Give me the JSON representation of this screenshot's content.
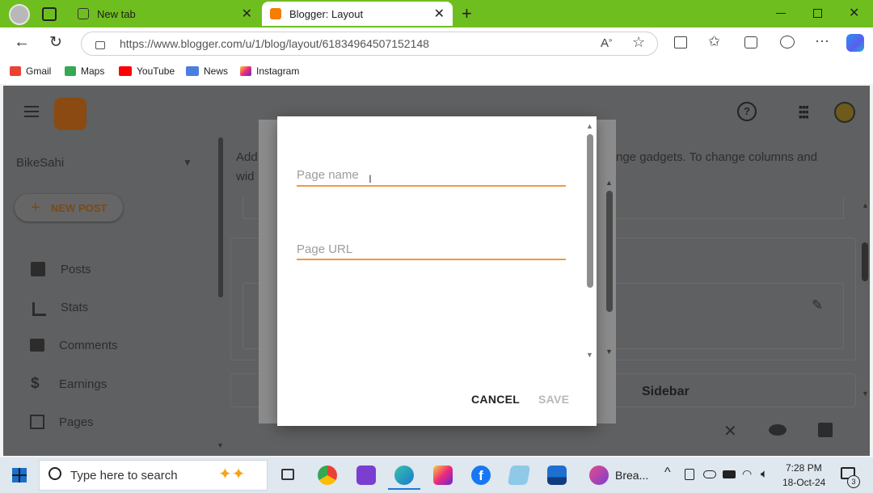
{
  "browser": {
    "tabs": [
      {
        "label": "New tab"
      },
      {
        "label": "Blogger: Layout"
      }
    ],
    "url": "https://www.blogger.com/u/1/blog/layout/61834964507152148",
    "bookmarks": [
      "Gmail",
      "Maps",
      "YouTube",
      "News",
      "Instagram"
    ]
  },
  "blogger": {
    "blog_name": "BikeSahi",
    "new_post": "NEW POST",
    "nav": [
      "Posts",
      "Stats",
      "Comments",
      "Earnings",
      "Pages"
    ],
    "intro_left_1": "Add",
    "intro_left_2": "wid",
    "intro_right": "nge gadgets. To change columns and",
    "sidebar_label": "Sidebar"
  },
  "dialog": {
    "page_name_placeholder": "Page name",
    "page_url_placeholder": "Page URL",
    "cancel": "CANCEL",
    "save": "SAVE"
  },
  "taskbar": {
    "search_placeholder": "Type here to search",
    "app_label": "Brea...",
    "time": "7:28 PM",
    "date": "18-Oct-24",
    "notifications": "3"
  },
  "colors": {
    "titlebar": "#6fbe1f",
    "accent": "#f09a3e",
    "blogger": "#f57d00"
  }
}
